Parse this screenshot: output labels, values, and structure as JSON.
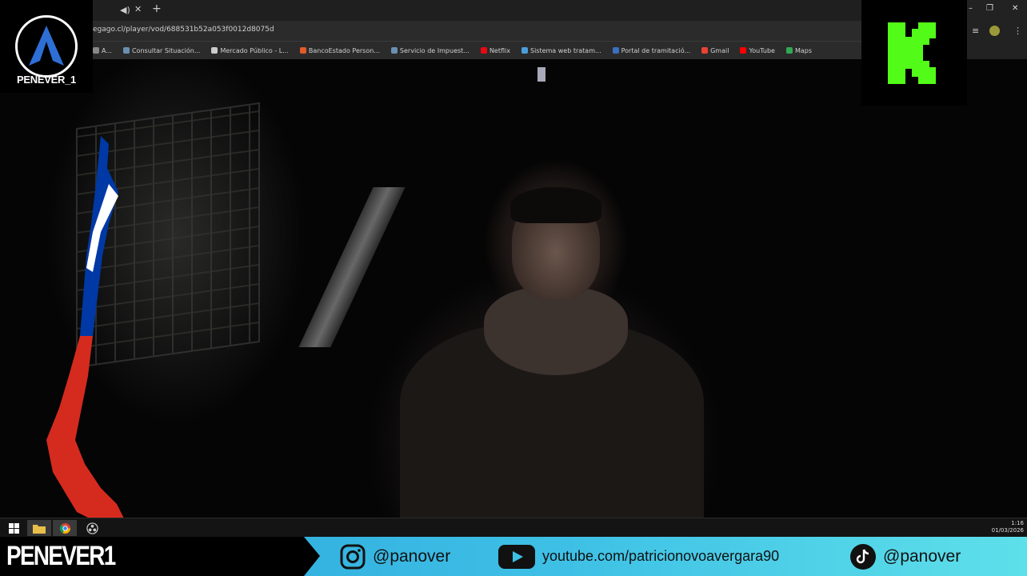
{
  "browser": {
    "tab_audio_icon": "speaker-icon",
    "url": "egago.cl/player/vod/688531b52a053f0012d8075d",
    "bookmarks": [
      {
        "label": "A...",
        "color": "#888888"
      },
      {
        "label": "Consultar Situación...",
        "color": "#6a8fb0"
      },
      {
        "label": "Mercado Público - L...",
        "color": "#cccccc"
      },
      {
        "label": "BancoEstado Person...",
        "color": "#e05a2a"
      },
      {
        "label": "Servicio de Impuest...",
        "color": "#6a8fb0"
      },
      {
        "label": "Netflix",
        "color": "#e50914"
      },
      {
        "label": "Sistema web tratam...",
        "color": "#4a9fd8"
      },
      {
        "label": "Portal de tramitació...",
        "color": "#3a6fc0"
      },
      {
        "label": "Gmail",
        "color": "#ea4335"
      },
      {
        "label": "YouTube",
        "color": "#ff0000"
      },
      {
        "label": "Maps",
        "color": "#34a853"
      }
    ]
  },
  "logo_left": {
    "text": "PENEVER_1"
  },
  "taskbar": {
    "time": "1:16",
    "date": "01/03/2026"
  },
  "social": {
    "brand": "PENEVER1",
    "instagram": "@panover",
    "youtube": "youtube.com/patricionovoavergara90",
    "tiktok": "@panover"
  },
  "colors": {
    "kick_green": "#53fc18",
    "flag_red": "#d52b1e",
    "flag_blue": "#0039a6"
  }
}
